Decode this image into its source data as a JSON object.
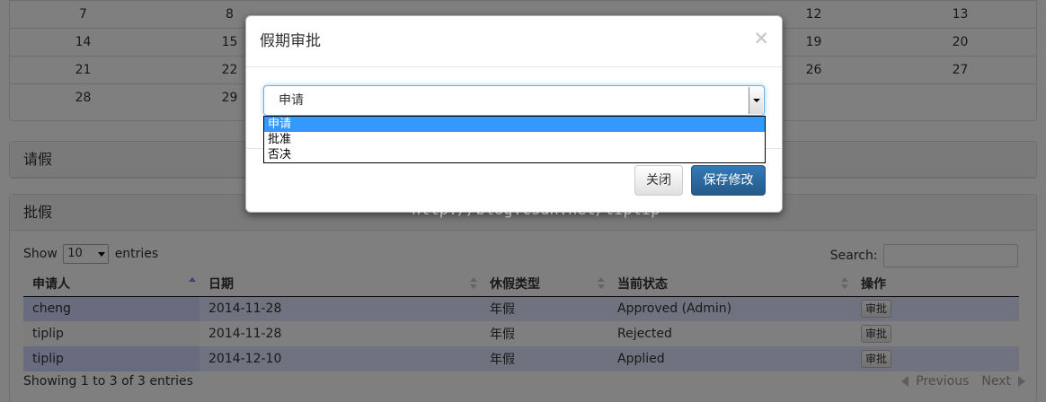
{
  "calendar": {
    "rows": [
      [
        "7",
        "8",
        "",
        "",
        "",
        "12",
        "13"
      ],
      [
        "14",
        "15",
        "",
        "",
        "",
        "19",
        "20"
      ],
      [
        "21",
        "22",
        "",
        "",
        "",
        "26",
        "27"
      ],
      [
        "28",
        "29",
        "",
        "",
        "",
        "",
        ""
      ]
    ]
  },
  "leave_panel": {
    "title": "请假"
  },
  "approve_panel": {
    "title": "批假",
    "show_label": "Show",
    "page_length": "10",
    "entries_label": "entries",
    "search_label": "Search:",
    "columns": [
      "申请人",
      "日期",
      "休假类型",
      "当前状态",
      "操作"
    ],
    "rows": [
      [
        "cheng",
        "2014-11-28",
        "年假",
        "Approved (Admin)",
        "审批"
      ],
      [
        "tiplip",
        "2014-11-28",
        "年假",
        "Rejected",
        "审批"
      ],
      [
        "tiplip",
        "2014-12-10",
        "年假",
        "Applied",
        "审批"
      ]
    ],
    "info": "Showing 1 to 3 of 3 entries",
    "previous_label": "Previous",
    "next_label": "Next"
  },
  "modal": {
    "title": "假期审批",
    "close_glyph": "×",
    "select_value": "申请",
    "options": [
      "申请",
      "批准",
      "否决"
    ],
    "selected_option": 0,
    "close_button": "关闭",
    "save_button": "保存修改"
  },
  "watermark": "http://blog.csdn.net/tiplip",
  "colors": {
    "primary": "#337ab7",
    "odd_row": "#e2e4ff",
    "sorted_odd": "#d3d6ff",
    "option_highlight": "#3399ff",
    "focus_border": "#66afe9"
  }
}
